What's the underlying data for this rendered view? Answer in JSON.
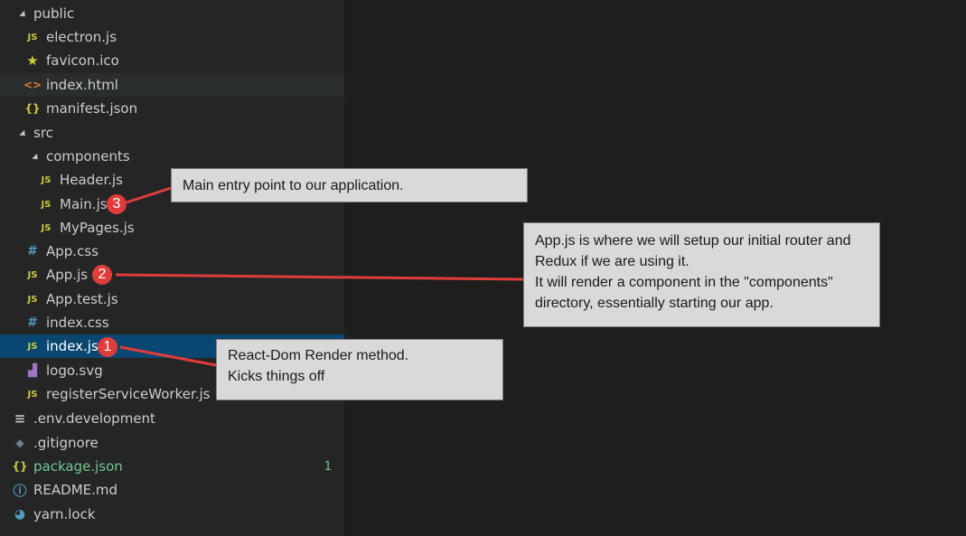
{
  "explorer": {
    "items": [
      {
        "label": "public",
        "type": "folder"
      },
      {
        "label": "electron.js",
        "type": "js"
      },
      {
        "label": "favicon.ico",
        "type": "star"
      },
      {
        "label": "index.html",
        "type": "html"
      },
      {
        "label": "manifest.json",
        "type": "json"
      },
      {
        "label": "src",
        "type": "folder"
      },
      {
        "label": "components",
        "type": "folder"
      },
      {
        "label": "Header.js",
        "type": "js"
      },
      {
        "label": "Main.js",
        "type": "js"
      },
      {
        "label": "MyPages.js",
        "type": "js"
      },
      {
        "label": "App.css",
        "type": "css"
      },
      {
        "label": "App.js",
        "type": "js"
      },
      {
        "label": "App.test.js",
        "type": "js"
      },
      {
        "label": "index.css",
        "type": "css"
      },
      {
        "label": "index.js",
        "type": "js"
      },
      {
        "label": "logo.svg",
        "type": "svg"
      },
      {
        "label": "registerServiceWorker.js",
        "type": "js"
      },
      {
        "label": ".env.development",
        "type": "lines"
      },
      {
        "label": ".gitignore",
        "type": "diamond"
      },
      {
        "label": "package.json",
        "type": "json",
        "status": "1"
      },
      {
        "label": "README.md",
        "type": "info"
      },
      {
        "label": "yarn.lock",
        "type": "yarn"
      }
    ]
  },
  "icon_text": {
    "js": "JS",
    "json": "{}",
    "html": "<>",
    "css": "#",
    "star": "★",
    "lines": "≡",
    "diamond": "◆",
    "info": "ⓘ",
    "svg": "▟",
    "yarn": "◕"
  },
  "colors": {
    "js": "#cbcb41",
    "json": "#cbcb41",
    "html": "#e37933",
    "css": "#519aba",
    "modified": "#73c991",
    "badge": "#e03c3c"
  },
  "annotations": {
    "callout_main": {
      "badge": "3",
      "lines": [
        "Main entry point to our application."
      ]
    },
    "callout_app": {
      "badge": "2",
      "lines": [
        "App.js is where we will setup our initial router and",
        "Redux if we are using it.",
        "It will render a component in the \"components\"",
        "directory, essentially starting our app."
      ]
    },
    "callout_index": {
      "badge": "1",
      "lines": [
        "React-Dom Render method.",
        "Kicks things off"
      ]
    }
  }
}
